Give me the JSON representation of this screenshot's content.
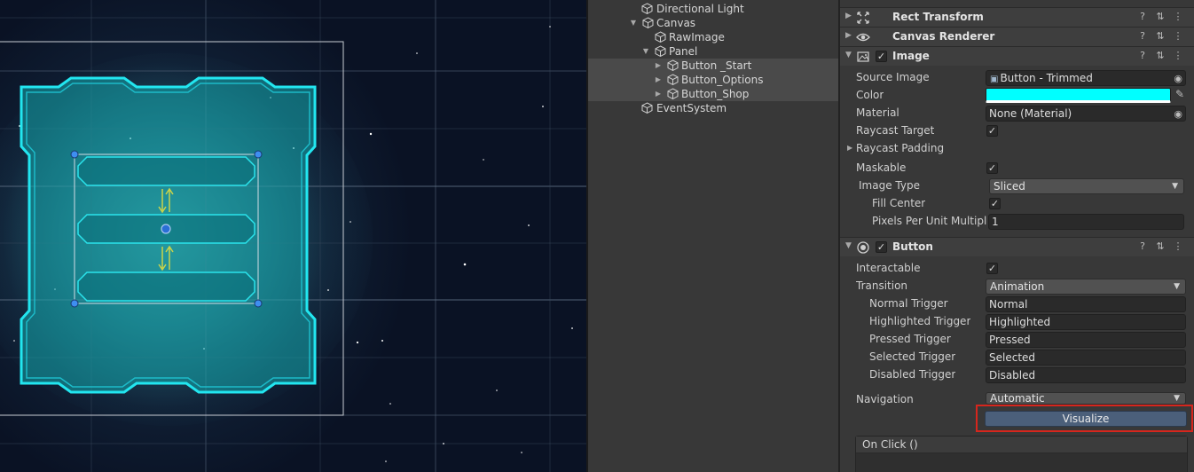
{
  "hierarchy": {
    "items": [
      {
        "label": "Directional Light",
        "indent": 3,
        "expanded": null,
        "selected": false
      },
      {
        "label": "Canvas",
        "indent": 2,
        "expanded": true,
        "selected": false
      },
      {
        "label": "RawImage",
        "indent": 3,
        "expanded": null,
        "selected": false
      },
      {
        "label": "Panel",
        "indent": 3,
        "expanded": true,
        "selected": false
      },
      {
        "label": "Button _Start",
        "indent": 4,
        "expanded": false,
        "selected": true
      },
      {
        "label": "Button_Options",
        "indent": 4,
        "expanded": false,
        "selected": true
      },
      {
        "label": "Button_Shop",
        "indent": 4,
        "expanded": false,
        "selected": true
      },
      {
        "label": "EventSystem",
        "indent": 2,
        "expanded": null,
        "selected": false
      }
    ]
  },
  "inspector": {
    "components": {
      "rect_transform": {
        "name": "Rect Transform"
      },
      "canvas_renderer": {
        "name": "Canvas Renderer"
      },
      "image": {
        "name": "Image",
        "enabled": "✓"
      },
      "button": {
        "name": "Button",
        "enabled": "✓"
      }
    },
    "header_icons": {
      "help": "?",
      "presets": "⇅",
      "menu": "⋮"
    },
    "image_props": {
      "source_image_label": "Source Image",
      "source_image_value": "Button - Trimmed",
      "color_label": "Color",
      "color_value": "#00ffff",
      "material_label": "Material",
      "material_value": "None (Material)",
      "raycast_target_label": "Raycast Target",
      "raycast_target": "✓",
      "raycast_padding_label": "Raycast Padding",
      "maskable_label": "Maskable",
      "maskable": "✓",
      "image_type_label": "Image Type",
      "image_type_value": "Sliced",
      "fill_center_label": "Fill Center",
      "fill_center": "✓",
      "ppu_label": "Pixels Per Unit Multiplie",
      "ppu_value": "1"
    },
    "button_props": {
      "interactable_label": "Interactable",
      "interactable": "✓",
      "transition_label": "Transition",
      "transition_value": "Animation",
      "normal_trigger_label": "Normal Trigger",
      "normal_trigger_value": "Normal",
      "highlighted_trigger_label": "Highlighted Trigger",
      "highlighted_trigger_value": "Highlighted",
      "pressed_trigger_label": "Pressed Trigger",
      "pressed_trigger_value": "Pressed",
      "selected_trigger_label": "Selected Trigger",
      "selected_trigger_value": "Selected",
      "disabled_trigger_label": "Disabled Trigger",
      "disabled_trigger_value": "Disabled",
      "navigation_label": "Navigation",
      "navigation_value": "Automatic",
      "visualize_label": "Visualize",
      "onclick_label": "On Click ()"
    }
  },
  "colors": {
    "accent_cyan": "#00ffff",
    "panel_outline": "#22e6f0",
    "highlight_red": "#d6261d",
    "visualize_blue": "#4b5f7a"
  }
}
